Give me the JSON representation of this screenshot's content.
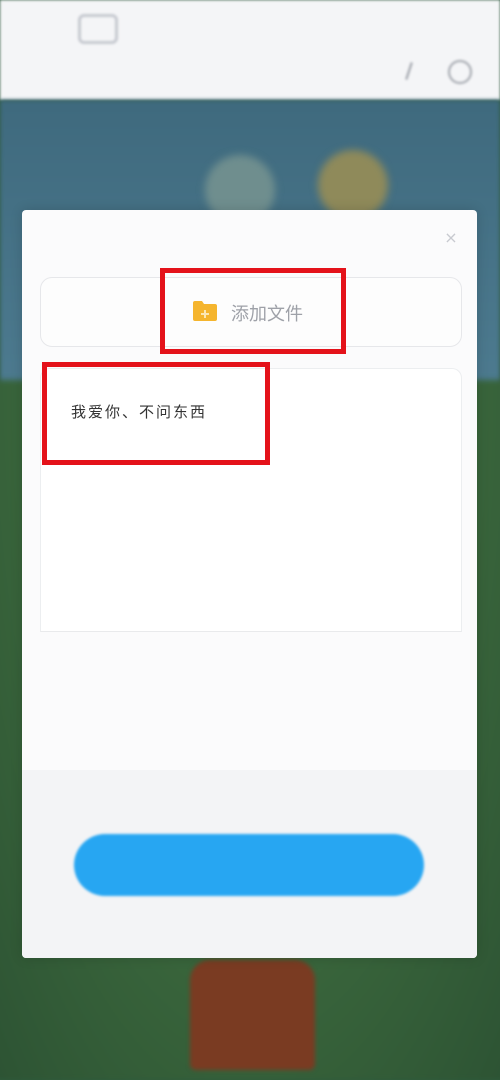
{
  "header": {
    "brand": "",
    "top_right": "",
    "page_title": ""
  },
  "modal": {
    "close_symbol": "×",
    "add_file_label": "添加文件",
    "text_content": "我爱你、不问东西",
    "char_counter": "",
    "submit_label": ""
  },
  "colors": {
    "highlight": "#e4121a",
    "primary_button": "#27a6f2",
    "folder": "#f5b52e"
  },
  "icons": {
    "close": "close-icon",
    "add_file": "folder-plus-icon"
  }
}
